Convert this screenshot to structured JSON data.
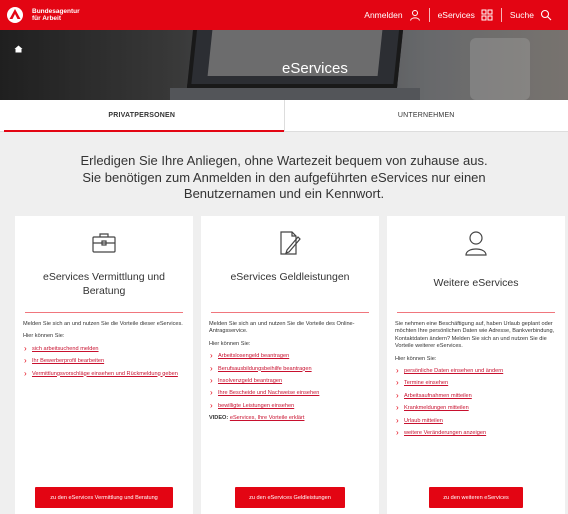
{
  "brand": {
    "name": "Bundesagentur für Arbeit",
    "line1": "Bundesagentur",
    "line2": "für Arbeit",
    "color": "#e30513"
  },
  "nav": {
    "login": {
      "label": "Anmelden",
      "icon": "user-icon"
    },
    "eservices": {
      "label": "eServices",
      "icon": "grid-icon"
    },
    "search": {
      "label": "Suche",
      "icon": "search-icon"
    }
  },
  "hero": {
    "title": "eServices",
    "home_icon": "home-icon"
  },
  "tabs": [
    {
      "label": "PRIVATPERSONEN",
      "active": true
    },
    {
      "label": "UNTERNEHMEN",
      "active": false
    }
  ],
  "intro": {
    "line1": "Erledigen Sie Ihre Anliegen, ohne Wartezeit bequem von zuhause aus.",
    "line2": "Sie benötigen zum Anmelden in den aufgeführten eServices nur einen",
    "line3": "Benutzernamen und ein Kennwort."
  },
  "cards": [
    {
      "icon": "briefcase-icon",
      "title": "eServices Vermittlung und Beratung",
      "intro": "Melden Sie sich an und nutzen Sie die Vorteile dieser eServices.",
      "list_heading": "Hier können Sie:",
      "links": [
        "sich arbeitsuchend melden",
        "Ihr Bewerberprofil bearbeiten",
        "Vermittlungsvorschläge einsehen und Rückmeldung geben"
      ],
      "button": "zu den eServices Vermittlung und Beratung"
    },
    {
      "icon": "document-pen-icon",
      "title": "eServices Geldleistungen",
      "intro": "Melden Sie sich an und nutzen Sie die Vorteile des Online-Antragsservice.",
      "list_heading": "Hier können Sie:",
      "links": [
        "Arbeitslosengeld beantragen",
        "Berufsausbildungsbeihilfe beantragen",
        "Insolvenzgeld beantragen",
        "Ihre Bescheide und Nachweise einsehen",
        "bewilligte Leistungen einsehen"
      ],
      "video_label": "VIDEO:",
      "video_link": "eServices, Ihre Vorteile erklärt",
      "button": "zu den eServices Geldleistungen"
    },
    {
      "icon": "person-icon",
      "title": "Weitere eServices",
      "intro": "Sie nehmen eine Beschäftigung auf, haben Urlaub geplant oder möchten Ihre persönlichen Daten wie Adresse, Bankverbindung, Kontaktdaten ändern? Melden Sie sich an und nutzen Sie die Vorteile weiterer eServices.",
      "list_heading": "Hier können Sie:",
      "links": [
        "persönliche Daten einsehen und ändern",
        "Termine einsehen",
        "Arbeitsaufnahmen mitteilen",
        "Krankmeldungen mitteilen",
        "Urlaub mitteilen",
        "weitere Veränderungen anzeigen"
      ],
      "button": "zu den weiteren eServices"
    }
  ]
}
